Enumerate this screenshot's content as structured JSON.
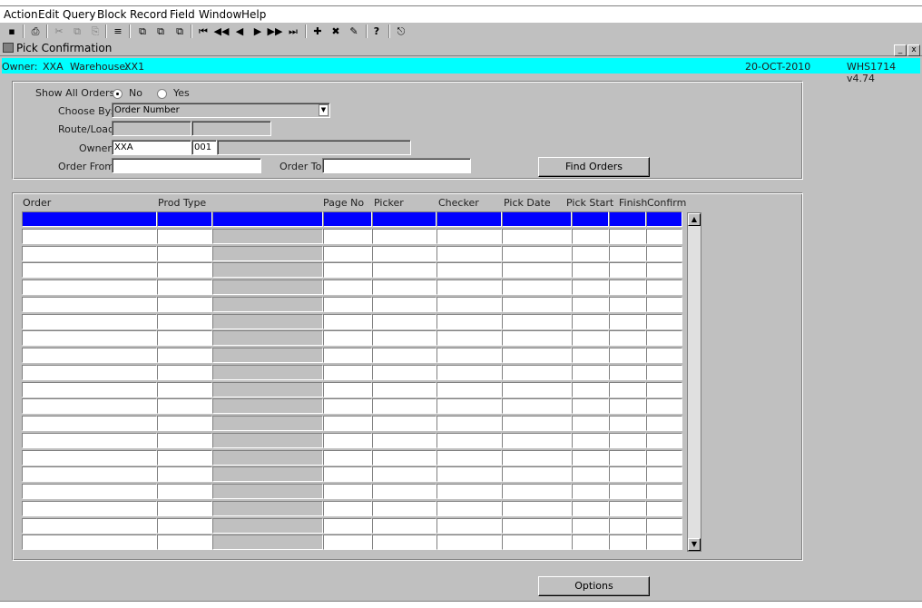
{
  "menu": [
    "Action",
    "Edit",
    "Query",
    "Block",
    "Record",
    "Field",
    "Window",
    "Help"
  ],
  "toolbar": {
    "icons": [
      "save-icon",
      "print-icon",
      "cut-icon",
      "copy-icon",
      "paste-icon",
      "list-icon",
      "copy-record-icon",
      "duplicate-icon",
      "clear-icon",
      "first-record-icon",
      "previous-block-icon",
      "previous-record-icon",
      "next-record-icon",
      "next-block-icon",
      "last-record-icon",
      "insert-record-icon",
      "delete-record-icon",
      "edit-icon",
      "help-icon",
      "exit-icon"
    ],
    "glyphs": [
      "▪",
      "⎙",
      "✂",
      "⧉",
      "⎘",
      "≡",
      "⧉",
      "⧉",
      "⧉",
      "⏮",
      "◀◀",
      "◀",
      "▶",
      "▶▶",
      "⏭",
      "✚",
      "✖",
      "✎",
      "?",
      "⎋"
    ]
  },
  "window": {
    "title": "Pick Confirmation",
    "min_label": "_",
    "close_label": "x"
  },
  "info": {
    "owner_label": "Owner:",
    "owner_value": "XXA",
    "warehouse_label": "Warehouse:",
    "warehouse_value": "XX1",
    "date": "20-OCT-2010",
    "version": "WHS1714 v4.74"
  },
  "form": {
    "show_all_orders_label": "Show All Orders :",
    "radio_no_label": "No",
    "radio_yes_label": "Yes",
    "radio_selected": "No",
    "choose_by_label": "Choose By:",
    "choose_by_value": "Order Number",
    "route_load_label": "Route/Load:",
    "route_value": "",
    "load_value": "",
    "owner_label": "Owner:",
    "owner_code": "XXA",
    "owner_number": "001",
    "owner_name": "",
    "order_from_label": "Order From:",
    "order_from_value": "",
    "order_to_label": "Order To:",
    "order_to_value": "",
    "find_button": "Find Orders"
  },
  "grid": {
    "columns": [
      "Order",
      "Prod Type",
      "",
      "Page No",
      "Picker",
      "Checker",
      "Pick Date",
      "Pick Start",
      "Finish",
      "Confirm"
    ],
    "row_count": 20,
    "selected_row": 0,
    "scroll_up": "▲",
    "scroll_down": "▼"
  },
  "footer": {
    "options_button": "Options"
  }
}
